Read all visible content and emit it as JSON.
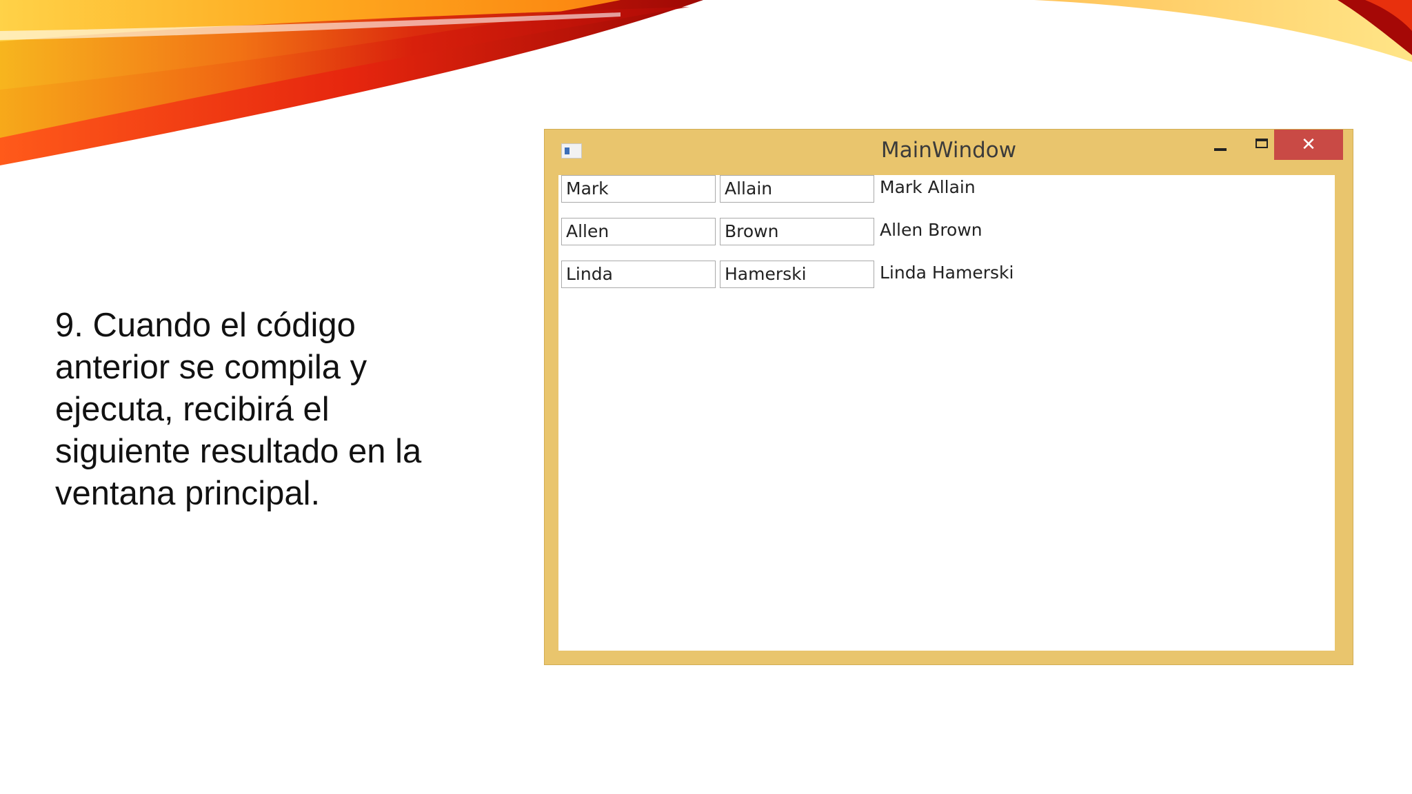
{
  "slide": {
    "text": " 9. Cuando el código\nanterior se compila y\nejecuta, recibirá el\nsiguiente resultado en la\nventana principal."
  },
  "window": {
    "title": "MainWindow",
    "close_glyph": "✕",
    "rows": [
      {
        "first": "Mark",
        "last": "Allain",
        "full": "Mark Allain"
      },
      {
        "first": "Allen",
        "last": "Brown",
        "full": "Allen Brown"
      },
      {
        "first": "Linda",
        "last": "Hamerski",
        "full": "Linda Hamerski"
      }
    ]
  },
  "colors": {
    "window_frame": "#e9c56d",
    "close_button": "#c94a45"
  }
}
